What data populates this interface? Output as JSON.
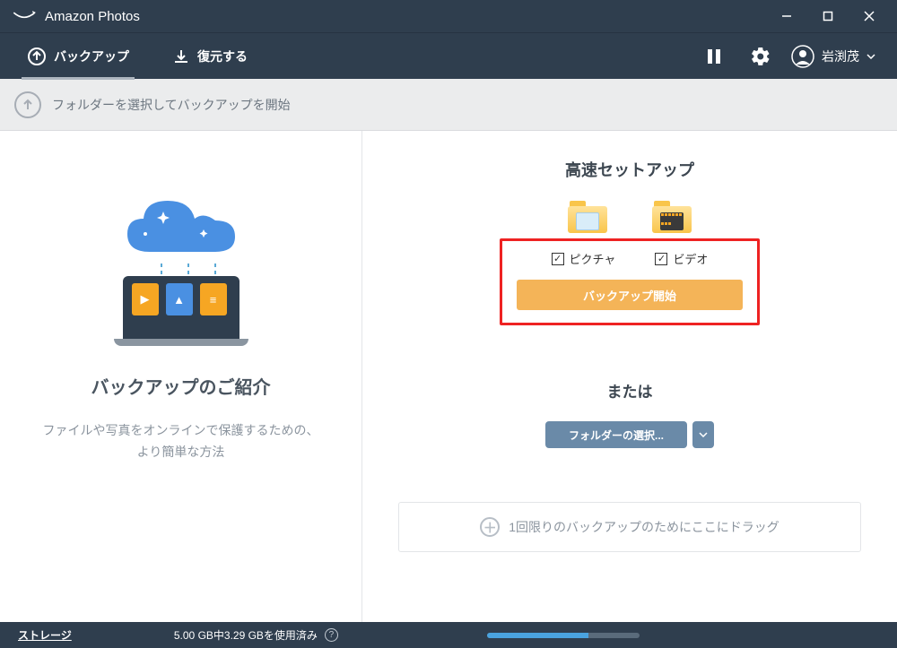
{
  "titlebar": {
    "app_name": "Amazon Photos"
  },
  "nav": {
    "backup_label": "バックアップ",
    "restore_label": "復元する",
    "user_name": "岩渕茂"
  },
  "subheader": {
    "text": "フォルダーを選択してバックアップを開始"
  },
  "left": {
    "title": "バックアップのご紹介",
    "desc_line1": "ファイルや写真をオンラインで保護するための、",
    "desc_line2": "より簡単な方法"
  },
  "right": {
    "quick_setup_title": "高速セットアップ",
    "check_pictures": "ピクチャ",
    "check_videos": "ビデオ",
    "start_button": "バックアップ開始",
    "or_title": "または",
    "select_folder_button": "フォルダーの選択...",
    "dropzone_text": "1回限りのバックアップのためにここにドラッグ"
  },
  "footer": {
    "storage_link": "ストレージ",
    "usage_text": "5.00 GB中3.29 GBを使用済み",
    "progress_pct": 66
  }
}
